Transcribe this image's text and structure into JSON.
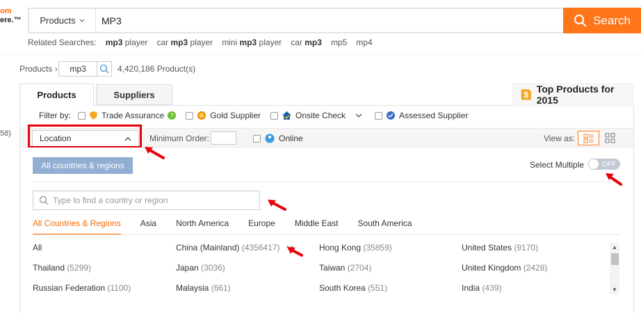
{
  "logo": {
    "line1": "om",
    "line2": "ere.™"
  },
  "search": {
    "category": "Products",
    "query": "MP3",
    "button_label": "Search"
  },
  "related": {
    "label": "Related Searches:",
    "items": [
      {
        "bold": "mp3",
        "rest": " player",
        "pre": ""
      },
      {
        "pre": "car ",
        "bold": "mp3",
        "rest": " player"
      },
      {
        "pre": "mini ",
        "bold": "mp3",
        "rest": " player"
      },
      {
        "pre": "car ",
        "bold": "mp3",
        "rest": ""
      },
      {
        "pre": "mp5",
        "bold": "",
        "rest": ""
      },
      {
        "pre": "mp4",
        "bold": "",
        "rest": ""
      }
    ]
  },
  "breadcrumb": {
    "label": "Products ›",
    "term": "mp3",
    "count": "4,420,186 Product(s)"
  },
  "tabs": {
    "products": "Products",
    "suppliers": "Suppliers"
  },
  "top_products": {
    "label": "Top Products for 2015",
    "icon_glyph": "$"
  },
  "side_number": "58)",
  "filters": {
    "label": "Filter by:",
    "trade_assurance": "Trade Assurance",
    "gold_supplier": "Gold Supplier",
    "onsite_check": "Onsite Check",
    "assessed_supplier": "Assessed Supplier"
  },
  "row2": {
    "location": "Location",
    "min_order_label": "Minimum Order:",
    "online": "Online",
    "view_as": "View as:"
  },
  "location_panel": {
    "all_button": "All countries & regions",
    "select_multiple": "Select Multiple",
    "toggle_state": "OFF",
    "search_placeholder": "Type to find a country or region",
    "region_tabs": [
      "All Countries & Regions",
      "Asia",
      "North America",
      "Europe",
      "Middle East",
      "South America"
    ],
    "countries": [
      {
        "name": "All",
        "count": ""
      },
      {
        "name": "China (Mainland)",
        "count": "(4356417)"
      },
      {
        "name": "Hong Kong",
        "count": "(35859)"
      },
      {
        "name": "United States",
        "count": "(9170)"
      },
      {
        "name": "Thailand",
        "count": "(5299)"
      },
      {
        "name": "Japan",
        "count": "(3036)"
      },
      {
        "name": "Taiwan",
        "count": "(2704)"
      },
      {
        "name": "United Kingdom",
        "count": "(2428)"
      },
      {
        "name": "Russian Federation",
        "count": "(1100)"
      },
      {
        "name": "Malaysia",
        "count": "(661)"
      },
      {
        "name": "South Korea",
        "count": "(551)"
      },
      {
        "name": "India",
        "count": "(439)"
      }
    ]
  },
  "colors": {
    "accent": "#ff6a00",
    "search_button": "#ff7519",
    "annotation_red": "#e8000a",
    "all_button": "#92aed2"
  }
}
